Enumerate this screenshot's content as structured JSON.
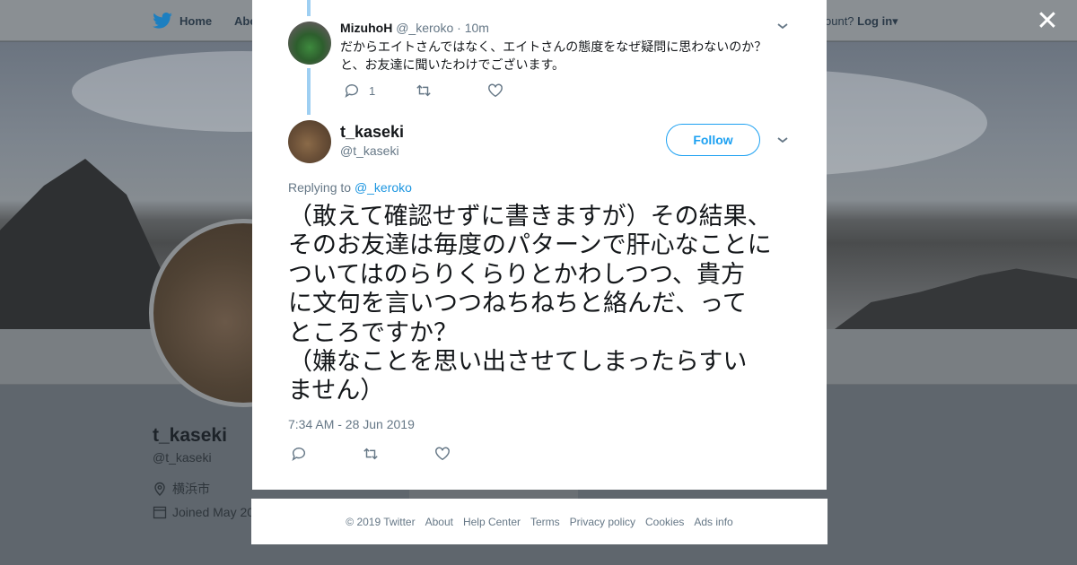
{
  "topbar": {
    "home_label": "Home",
    "about_label": "Abo",
    "account_text": "ccount?",
    "login_label": "Log in"
  },
  "profile": {
    "name": "t_kaseki",
    "handle": "@t_kaseki",
    "location": "横浜市",
    "joined": "Joined May 20"
  },
  "reply_tweet": {
    "name": "MizuhoH",
    "handle": "@_keroko",
    "time": "· 10m",
    "text_line1": "だからエイトさんではなく、エイトさんの態度をなぜ疑問に思わないのか？",
    "text_line2": "と、お友達に聞いたわけでございます。",
    "reply_count": "1"
  },
  "main_tweet": {
    "name": "t_kaseki",
    "handle": "@t_kaseki",
    "follow_label": "Follow",
    "replying_prefix": "Replying to",
    "replying_to": "@_keroko",
    "text": "（敢えて確認せずに書きますが）その結果、\nそのお友達は毎度のパターンで肝心なことに\nついてはのらりくらりとかわしつつ、貴方\nに文句を言いつつねちねちと絡んだ、って\nところですか？\n（嫌なことを思い出させてしまったらすい\nません）",
    "timestamp": "7:34 AM - 28 Jun 2019"
  },
  "footer": {
    "copyright": "© 2019 Twitter",
    "links": [
      "About",
      "Help Center",
      "Terms",
      "Privacy policy",
      "Cookies",
      "Ads info"
    ]
  },
  "colors": {
    "accent": "#1da1f2",
    "thread_line": "#9ecff2",
    "secondary_text": "#657786",
    "primary_text": "#14171a"
  },
  "icons": [
    "twitter-bird-icon",
    "close-icon",
    "chevron-down-icon",
    "reply-icon",
    "retweet-icon",
    "like-icon",
    "location-icon",
    "calendar-icon"
  ]
}
